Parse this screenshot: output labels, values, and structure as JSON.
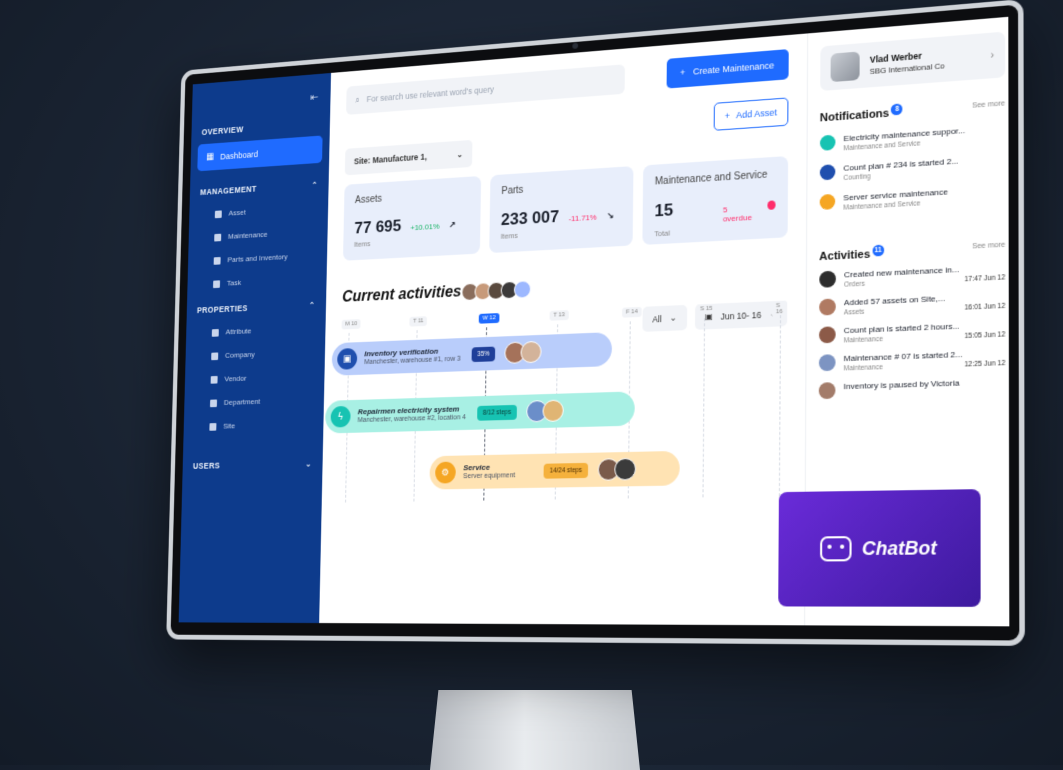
{
  "sidebar": {
    "sections": [
      {
        "title": "OVERVIEW"
      },
      {
        "title": "MANAGEMENT"
      },
      {
        "title": "PROPERTIES"
      },
      {
        "title": "USERS"
      }
    ],
    "active_item": "Dashboard",
    "management_items": [
      "Asset",
      "Maintenance",
      "Parts and Inventory",
      "Task"
    ],
    "properties_items": [
      "Attribute",
      "Company",
      "Vendor",
      "Department",
      "Site"
    ]
  },
  "search": {
    "placeholder": "For search use relevant word's query"
  },
  "buttons": {
    "create": "Create Maintenance",
    "add_asset": "Add Asset"
  },
  "site_select": "Site: Manufacture 1,",
  "stats": {
    "assets": {
      "label": "Assets",
      "value": "77 695",
      "delta": "+10.01%",
      "sub": "Items"
    },
    "parts": {
      "label": "Parts",
      "value": "233 007",
      "delta": "-11.71%",
      "sub": "Items"
    },
    "maintenance": {
      "label": "Maintenance and Service",
      "value": "15",
      "overdue": "5 overdue",
      "sub": "Total"
    }
  },
  "activities_section": {
    "title": "Current activities",
    "filter_all": "All",
    "date_range": "Jun 10- 16",
    "days": [
      "M 10",
      "T 11",
      "W 12",
      "T 13",
      "F 14",
      "S 15",
      "S 16"
    ],
    "tasks": [
      {
        "title": "Inventory verification",
        "sub": "Manchester, warehouse #1, row 3",
        "progress": "35%"
      },
      {
        "title": "Repairmen electricity system",
        "sub": "Manchester, warehouse #2, location 4",
        "progress": "8/12 steps"
      },
      {
        "title": "Service",
        "sub": "Server equipment",
        "progress": "14/24 steps"
      }
    ]
  },
  "profile": {
    "name": "Vlad Werber",
    "company": "SBG International Co"
  },
  "notifications": {
    "title": "Notifications",
    "count": "8",
    "see_more": "See more",
    "items": [
      {
        "title": "Electricity maintenance suppor...",
        "sub": "Maintenance and Service"
      },
      {
        "title": "Count plan # 234 is started 2...",
        "sub": "Counting"
      },
      {
        "title": "Server service maintenance",
        "sub": "Maintenance and Service"
      }
    ]
  },
  "activities": {
    "title": "Activities",
    "count": "11",
    "see_more": "See more",
    "items": [
      {
        "title": "Created new maintenance in...",
        "sub": "Orders",
        "time": "17:47",
        "date": "Jun 12"
      },
      {
        "title": "Added 57 assets on Site,...",
        "sub": "Assets",
        "time": "16:01",
        "date": "Jun 12"
      },
      {
        "title": "Count plan is started 2 hours...",
        "sub": "Maintenance",
        "time": "15:05",
        "date": "Jun 12"
      },
      {
        "title": "Maintenance # 07 is started 2...",
        "sub": "Maintenance",
        "time": "12:25",
        "date": "Jun 12"
      },
      {
        "title": "Inventory is paused by Victoria"
      }
    ]
  },
  "chatbot": {
    "label": "ChatBot"
  },
  "colors": {
    "primary": "#1f6bff",
    "sidebar": "#0d3b8c",
    "chatbot": "#5a22c4",
    "positive": "#16b364",
    "negative": "#ff2d6b"
  }
}
